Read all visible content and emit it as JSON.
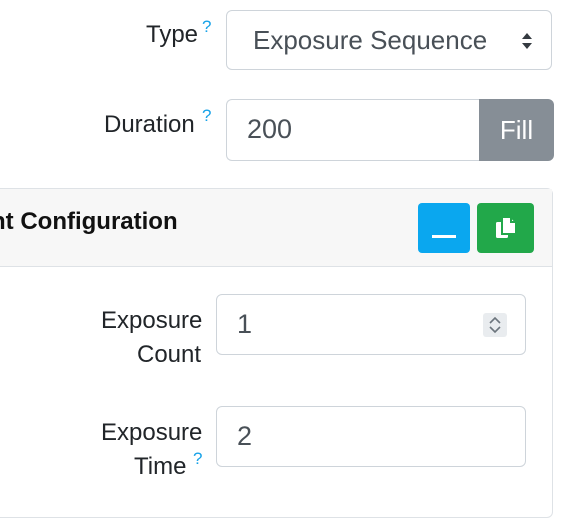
{
  "form": {
    "type": {
      "label": "Type",
      "help": "?",
      "value": "Exposure Sequence"
    },
    "duration": {
      "label": "Duration",
      "help": "?",
      "value": "200",
      "fill_label": "Fill"
    }
  },
  "card": {
    "title": "nt Configuration",
    "exposure_count": {
      "label_line1": "Exposure",
      "label_line2": "Count",
      "value": "1"
    },
    "exposure_time": {
      "label_line1": "Exposure",
      "label_line2": "Time",
      "help": "?",
      "value": "2"
    }
  },
  "colors": {
    "help": "#17a2e8",
    "minimize_button": "#0aa7ef",
    "copy_button": "#22a84a",
    "fill_button": "#868e96"
  }
}
